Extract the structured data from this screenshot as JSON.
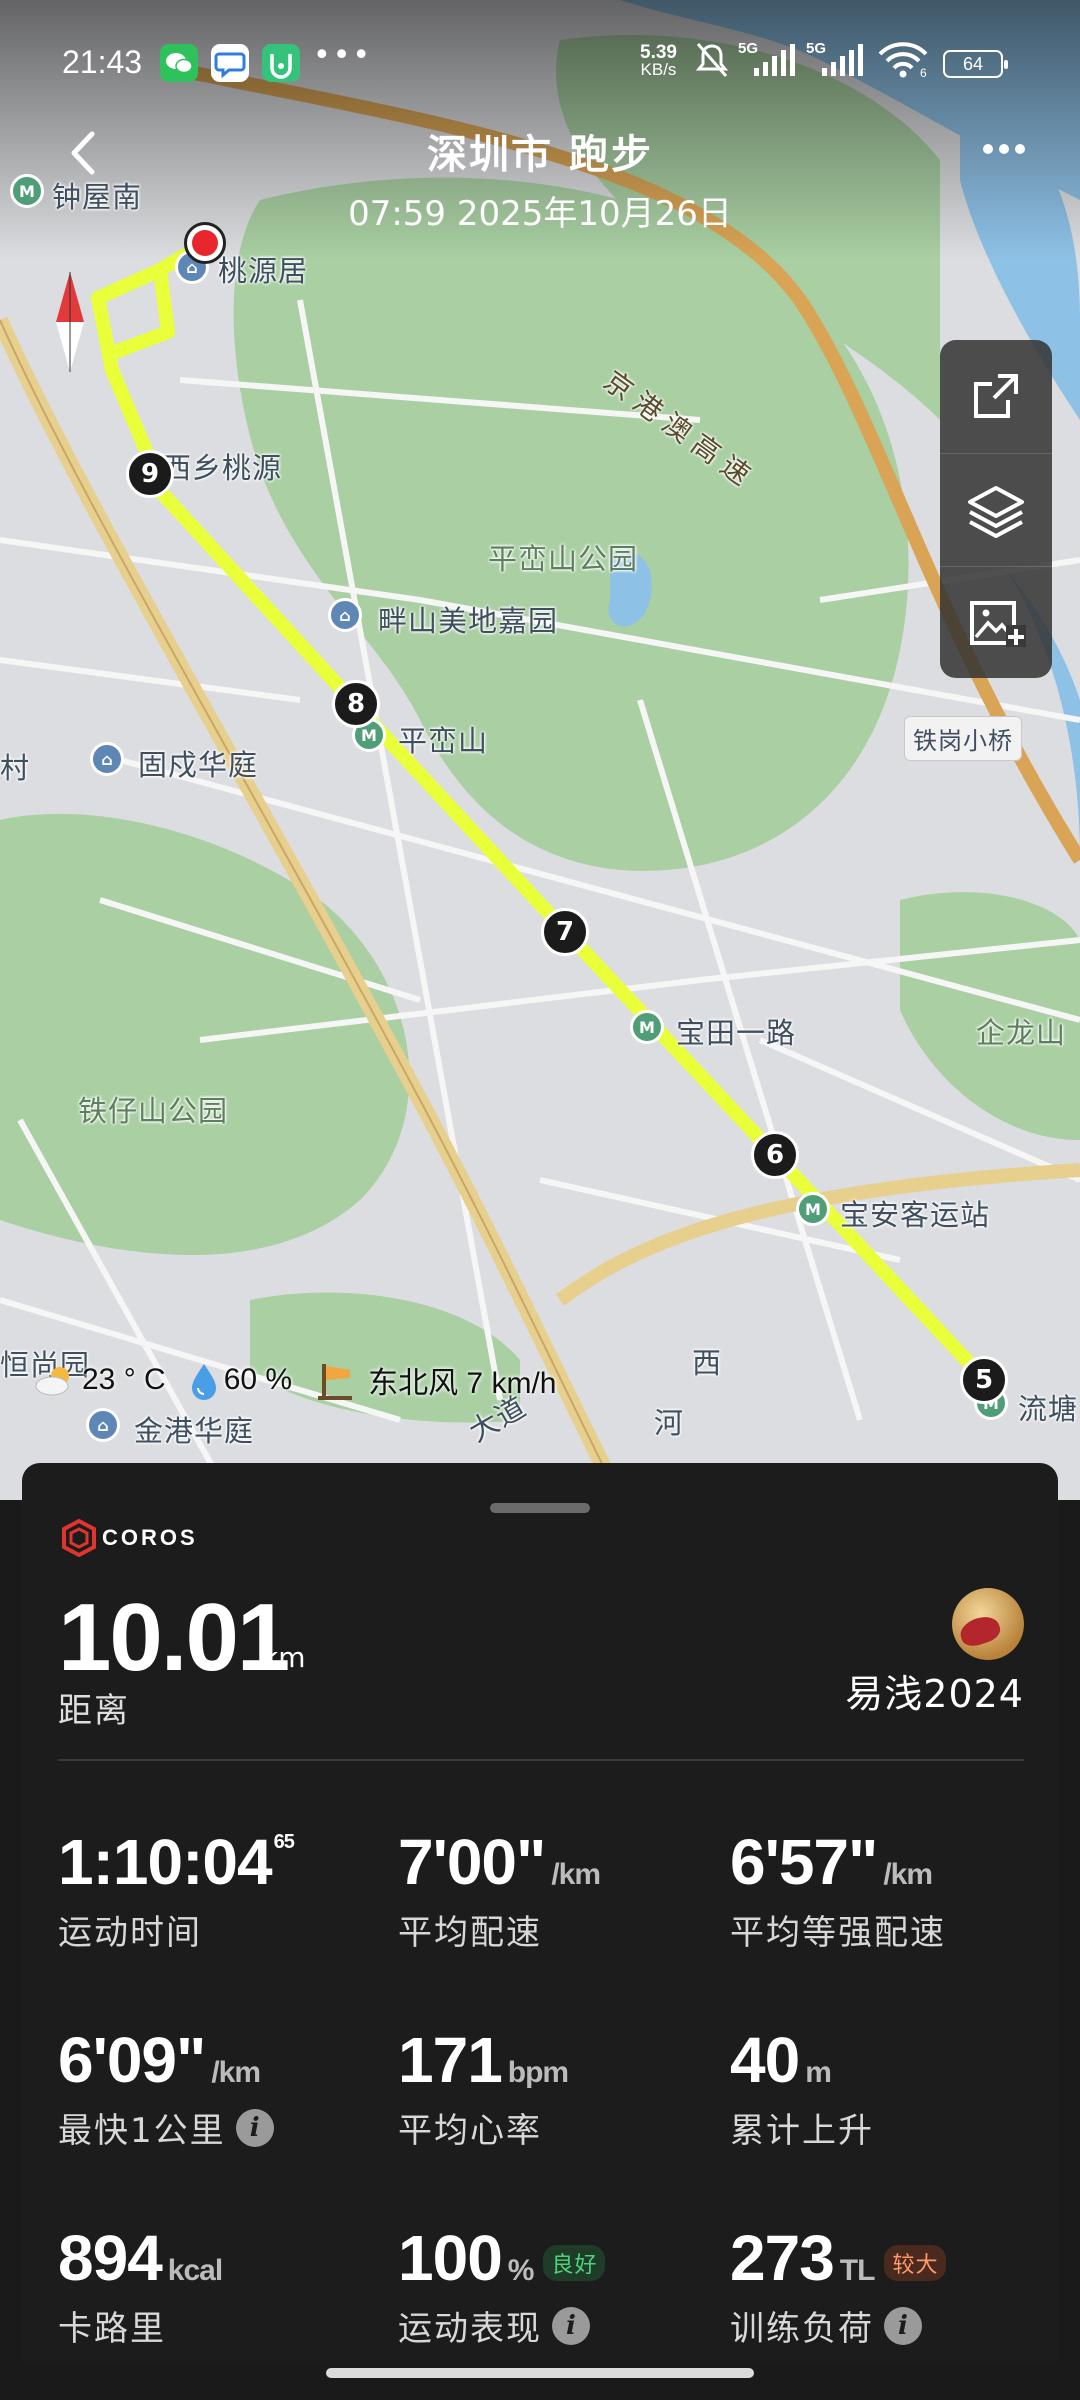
{
  "status_bar": {
    "time": "21:43",
    "net_speed_value": "5.39",
    "net_speed_unit": "KB/s",
    "sim1": "5G",
    "sim2": "5G",
    "battery": "64",
    "wifi_num": "6"
  },
  "header": {
    "title": "深圳市 跑步",
    "datetime": "07:59 2025年10月26日"
  },
  "map": {
    "labels": {
      "zhongwunan": "钟屋南",
      "taoyuanju": "桃源居",
      "xixiang_taoyuan": "西乡桃源",
      "pingluanshan_park": "平峦山公园",
      "panshan_meidi": "畔山美地嘉园",
      "pingluanshan": "平峦山",
      "gurong_huating": "固戍华庭",
      "cun": "村",
      "tiegang_bridge": "铁岗小桥",
      "baotian_road": "宝田一路",
      "qilong": "企龙山",
      "tiezaishan_park": "铁仔山公园",
      "baoan_bus": "宝安客运站",
      "hengshang": "恒尚园",
      "jingang_huating": "金港华庭",
      "liutang": "流塘",
      "highway": "京港澳高速",
      "xi": "西",
      "he": "河",
      "dadao": "大道"
    },
    "km_markers": [
      "9",
      "8",
      "7",
      "6",
      "5"
    ],
    "colors": {
      "route": "#e8ff3a",
      "green": "#a8cfa2",
      "water": "#8ec1e6",
      "highway": "#d9a455"
    }
  },
  "weather": {
    "temperature": "23 ° C",
    "humidity": "60 %",
    "wind": "东北风 7 km/h"
  },
  "summary": {
    "brand": "COROS",
    "distance_value": "10.01",
    "distance_unit": "km",
    "distance_label": "距离",
    "username": "易浅2024",
    "stats": {
      "time": {
        "value": "1:10:04",
        "sup": "65",
        "label": "运动时间"
      },
      "avg_pace": {
        "value": "7'00\"",
        "unit": "/km",
        "label": "平均配速"
      },
      "grade_pace": {
        "value": "6'57\"",
        "unit": "/km",
        "label": "平均等强配速"
      },
      "fastest_km": {
        "value": "6'09\"",
        "unit": "/km",
        "label": "最快1公里"
      },
      "heart_rate": {
        "value": "171",
        "unit": "bpm",
        "label": "平均心率"
      },
      "elevation": {
        "value": "40",
        "unit": "m",
        "label": "累计上升"
      },
      "calories": {
        "value": "894",
        "unit": "kcal",
        "label": "卡路里"
      },
      "performance": {
        "value": "100",
        "unit": "%",
        "badge": "良好",
        "label": "运动表现"
      },
      "training_load": {
        "value": "273",
        "unit": "TL",
        "badge": "较大",
        "label": "训练负荷"
      }
    },
    "info_glyph": "i"
  }
}
